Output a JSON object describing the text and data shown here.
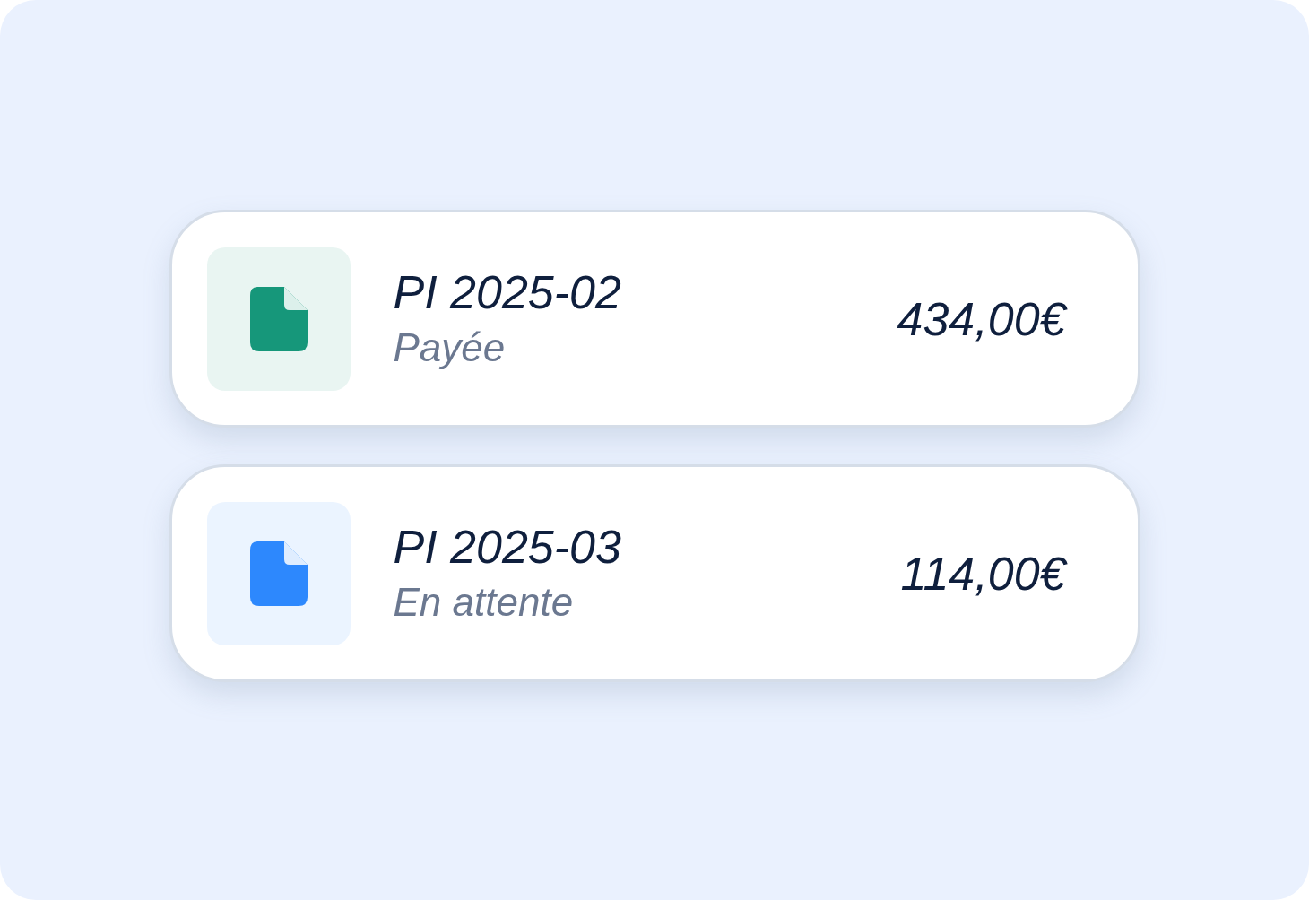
{
  "invoices": [
    {
      "title": "PI 2025-02",
      "status": "Payée",
      "amount": "434,00€",
      "color": "#16977a"
    },
    {
      "title": "PI 2025-03",
      "status": "En attente",
      "amount": "114,00€",
      "color": "#2d88fd"
    }
  ]
}
